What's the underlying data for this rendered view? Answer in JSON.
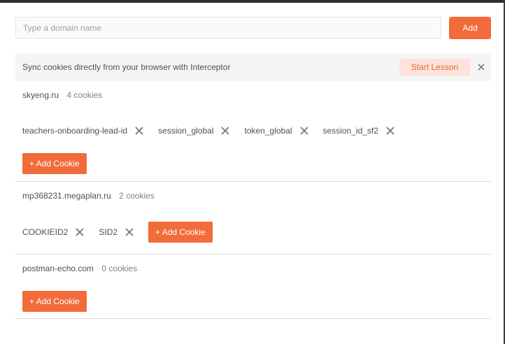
{
  "domain_input": {
    "placeholder": "Type a domain name",
    "value": ""
  },
  "add_button": {
    "label": "Add"
  },
  "banner": {
    "text": "Sync cookies directly from your browser with Interceptor",
    "start_lesson_label": "Start Lesson",
    "close_icon": "close-icon"
  },
  "domains": [
    {
      "name": "skyeng.ru",
      "count_label": "4 cookies",
      "cookies": [
        {
          "name": "teachers-onboarding-lead-id"
        },
        {
          "name": "session_global"
        },
        {
          "name": "token_global"
        },
        {
          "name": "session_id_sf2"
        }
      ],
      "add_cookie_label": "+ Add Cookie"
    },
    {
      "name": "mp368231.megaplan.ru",
      "count_label": "2 cookies",
      "cookies": [
        {
          "name": "COOKIEID2"
        },
        {
          "name": "SID2"
        }
      ],
      "add_cookie_label": "+ Add Cookie"
    },
    {
      "name": "postman-echo.com",
      "count_label": "0 cookies",
      "cookies": [],
      "add_cookie_label": "+ Add Cookie"
    }
  ],
  "colors": {
    "accent": "#f26b3a",
    "accent_soft": "#fde3d9",
    "text": "#505050",
    "muted": "#808080",
    "banner_bg": "#f5f5f5",
    "divider": "#d9d9d9"
  }
}
